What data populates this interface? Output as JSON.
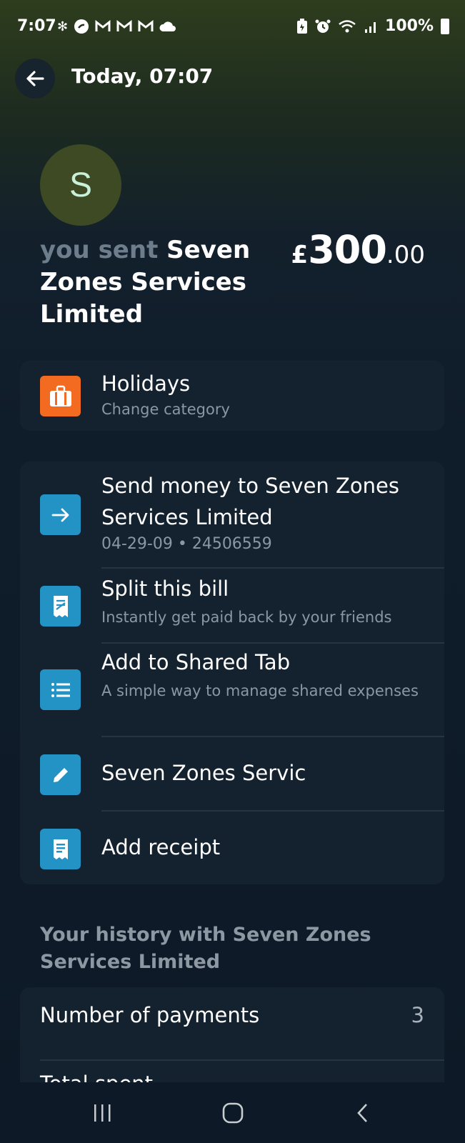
{
  "status_bar": {
    "time": "7:07",
    "notification_icons": [
      "bluetooth-asterisk-icon",
      "shazam-icon",
      "gmail-icon",
      "gmail-icon",
      "gmail-icon",
      "cloud-icon"
    ],
    "system_icons": [
      "battery-saver-icon",
      "alarm-icon",
      "wifi-icon",
      "signal-icon"
    ],
    "battery": "100%"
  },
  "header": {
    "title": "Today, 07:07"
  },
  "transaction": {
    "avatar_letter": "S",
    "prefix": "you sent",
    "payee": "Seven Zones Services Limited",
    "amount_currency": "£",
    "amount_whole": "300",
    "amount_decimal": ".00"
  },
  "category": {
    "title": "Holidays",
    "subtitle": "Change category",
    "icon": "suitcase-icon",
    "color": "#f26b21"
  },
  "actions": [
    {
      "title": "Send money to Seven Zones Services Limited",
      "subtitle": "04-29-09 • 24506559",
      "icon": "arrow-right-icon"
    },
    {
      "title": "Split this bill",
      "subtitle": "Instantly get paid back by your friends",
      "icon": "split-bill-icon"
    },
    {
      "title": "Add to Shared Tab",
      "subtitle": "A simple way to manage shared expenses",
      "icon": "list-icon"
    },
    {
      "title": "Seven Zones Servic",
      "subtitle": "",
      "icon": "pencil-icon"
    },
    {
      "title": "Add receipt",
      "subtitle": "",
      "icon": "receipt-icon"
    }
  ],
  "action_icon_color": "#2393c6",
  "history": {
    "title": "Your history with Seven Zones Services Limited",
    "stats": [
      {
        "label": "Number of payments",
        "value": "3"
      },
      {
        "label": "Total spent",
        "value": ""
      }
    ]
  }
}
